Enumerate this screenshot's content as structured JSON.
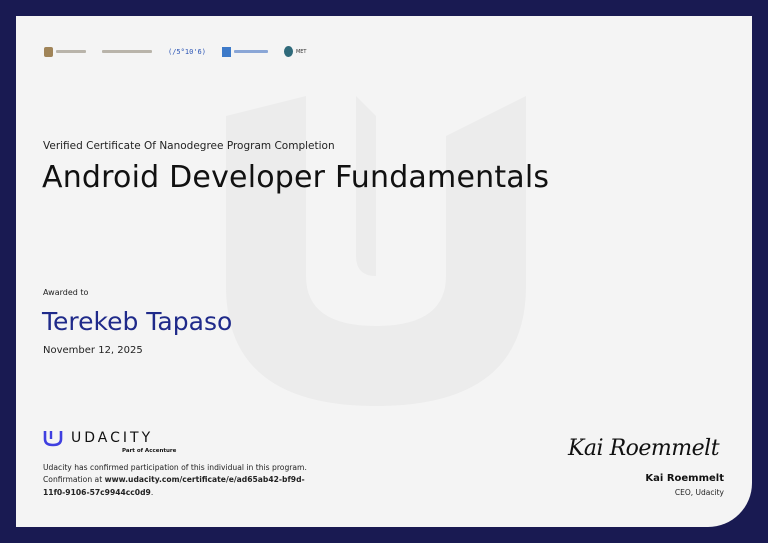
{
  "certificate": {
    "subtitle": "Verified Certificate Of Nanodegree Program Completion",
    "title": "Android Developer Fundamentals",
    "awarded_label": "Awarded to",
    "recipient": "Terekeb Tapaso",
    "date": "November 12, 2025"
  },
  "logos": [
    "uae-emblem-logo",
    "arabic-ministry-logo",
    "5-10-6-logo",
    "ministry-building-logo",
    "met-logo"
  ],
  "brand": {
    "name": "UDACITY",
    "tagline": "Part of Accenture",
    "confirmation_prefix": "Udacity has confirmed participation of this individual in this program. Confirmation at ",
    "confirmation_url": "www.udacity.com/certificate/e/ad65ab42-bf9d-11f0-9106-57c9944cc0d9",
    "confirmation_suffix": "."
  },
  "signature": {
    "script": "Kai Roemmelt",
    "name": "Kai Roemmelt",
    "role": "CEO, Udacity"
  },
  "colors": {
    "frame": "#191a52",
    "card": "#f4f4f4",
    "accent": "#1f2a8a",
    "logo_blue": "#3f3fe0"
  }
}
